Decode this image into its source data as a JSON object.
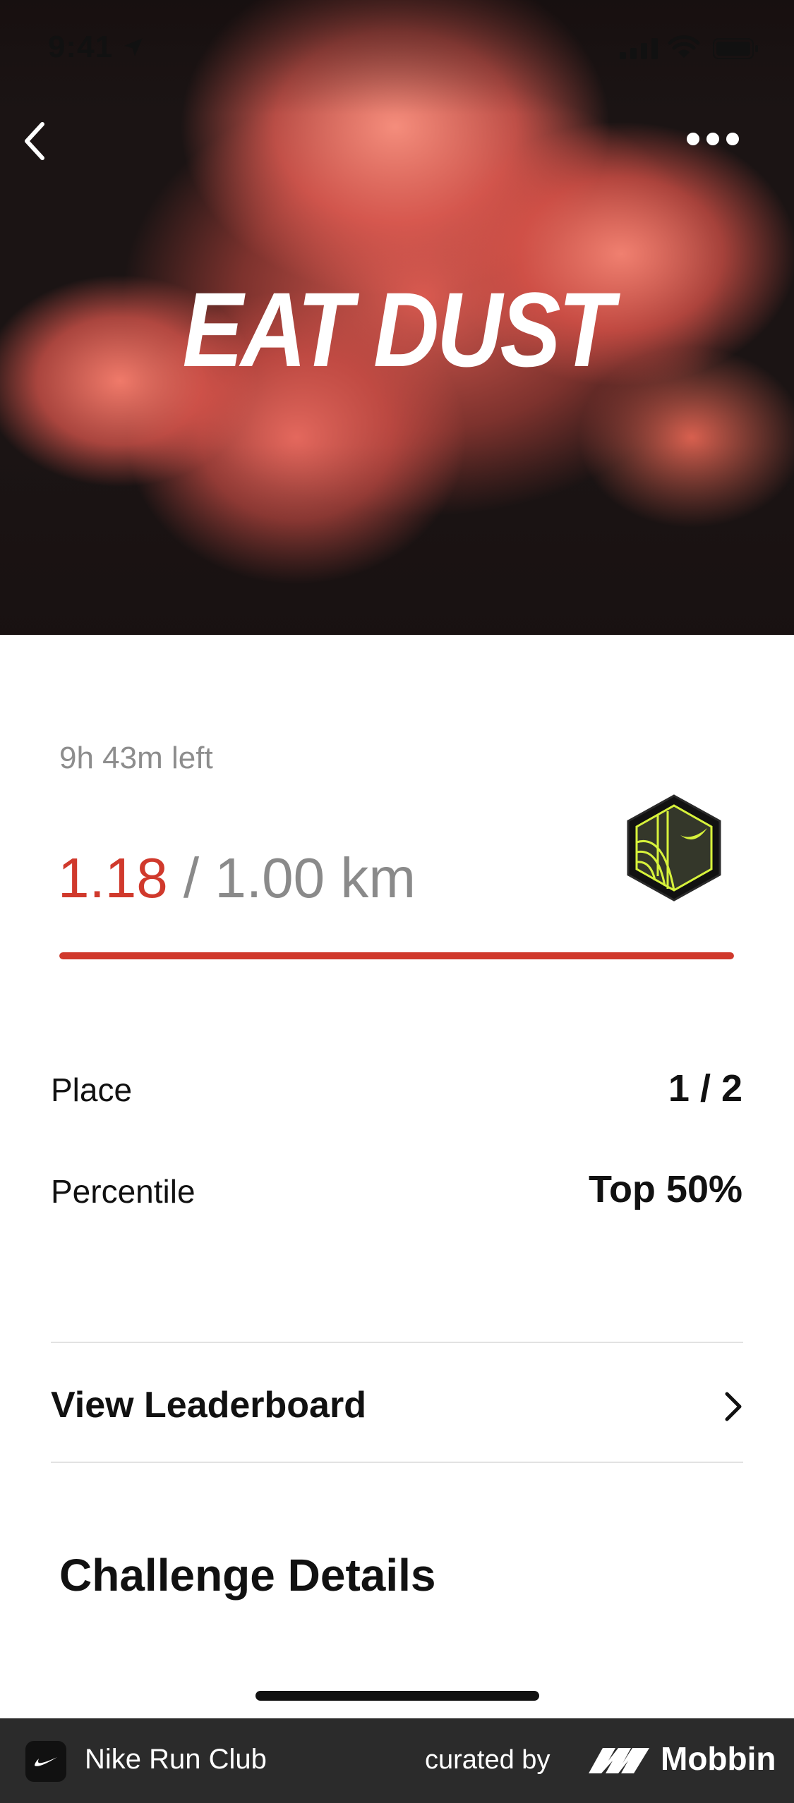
{
  "status_bar": {
    "time": "9:41"
  },
  "hero": {
    "title": "EAT DUST"
  },
  "challenge": {
    "time_left": "9h 43m left",
    "current_distance": "1.18",
    "goal_distance": " / 1.00 km",
    "progress_fraction": 1.0,
    "accent_color": "#d0392c"
  },
  "stats": [
    {
      "label": "Place",
      "value": "1 / 2"
    },
    {
      "label": "Percentile",
      "value": "Top 50%"
    }
  ],
  "leaderboard": {
    "label": "View Leaderboard"
  },
  "details": {
    "title": "Challenge Details"
  },
  "footer": {
    "app_name": "Nike Run Club",
    "curated_by": "curated by",
    "brand": "Mobbin"
  },
  "icons": [
    "back-arrow-icon",
    "more-icon",
    "location-arrow-icon",
    "signal-icon",
    "wifi-icon",
    "battery-icon",
    "challenge-badge-icon",
    "chevron-right-icon"
  ]
}
